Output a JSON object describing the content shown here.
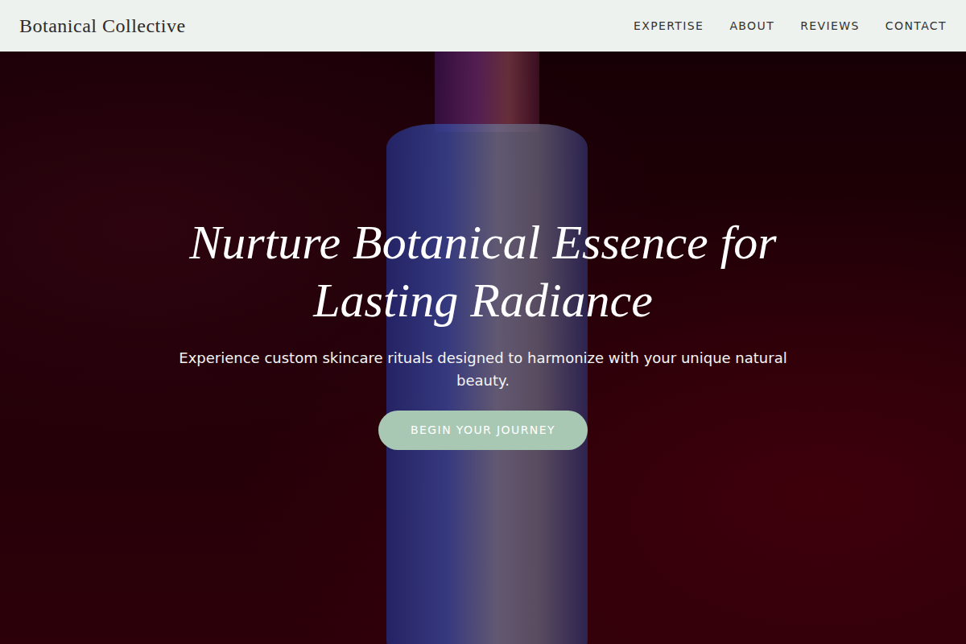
{
  "brand": "Botanical Collective",
  "nav": [
    {
      "label": "EXPERTISE"
    },
    {
      "label": "ABOUT"
    },
    {
      "label": "REVIEWS"
    },
    {
      "label": "CONTACT"
    }
  ],
  "hero": {
    "title": "Nurture Botanical Essence for Lasting Radiance",
    "subtitle": "Experience custom skincare rituals designed to harmonize with your unique natural beauty.",
    "cta": "BEGIN YOUR JOURNEY"
  }
}
